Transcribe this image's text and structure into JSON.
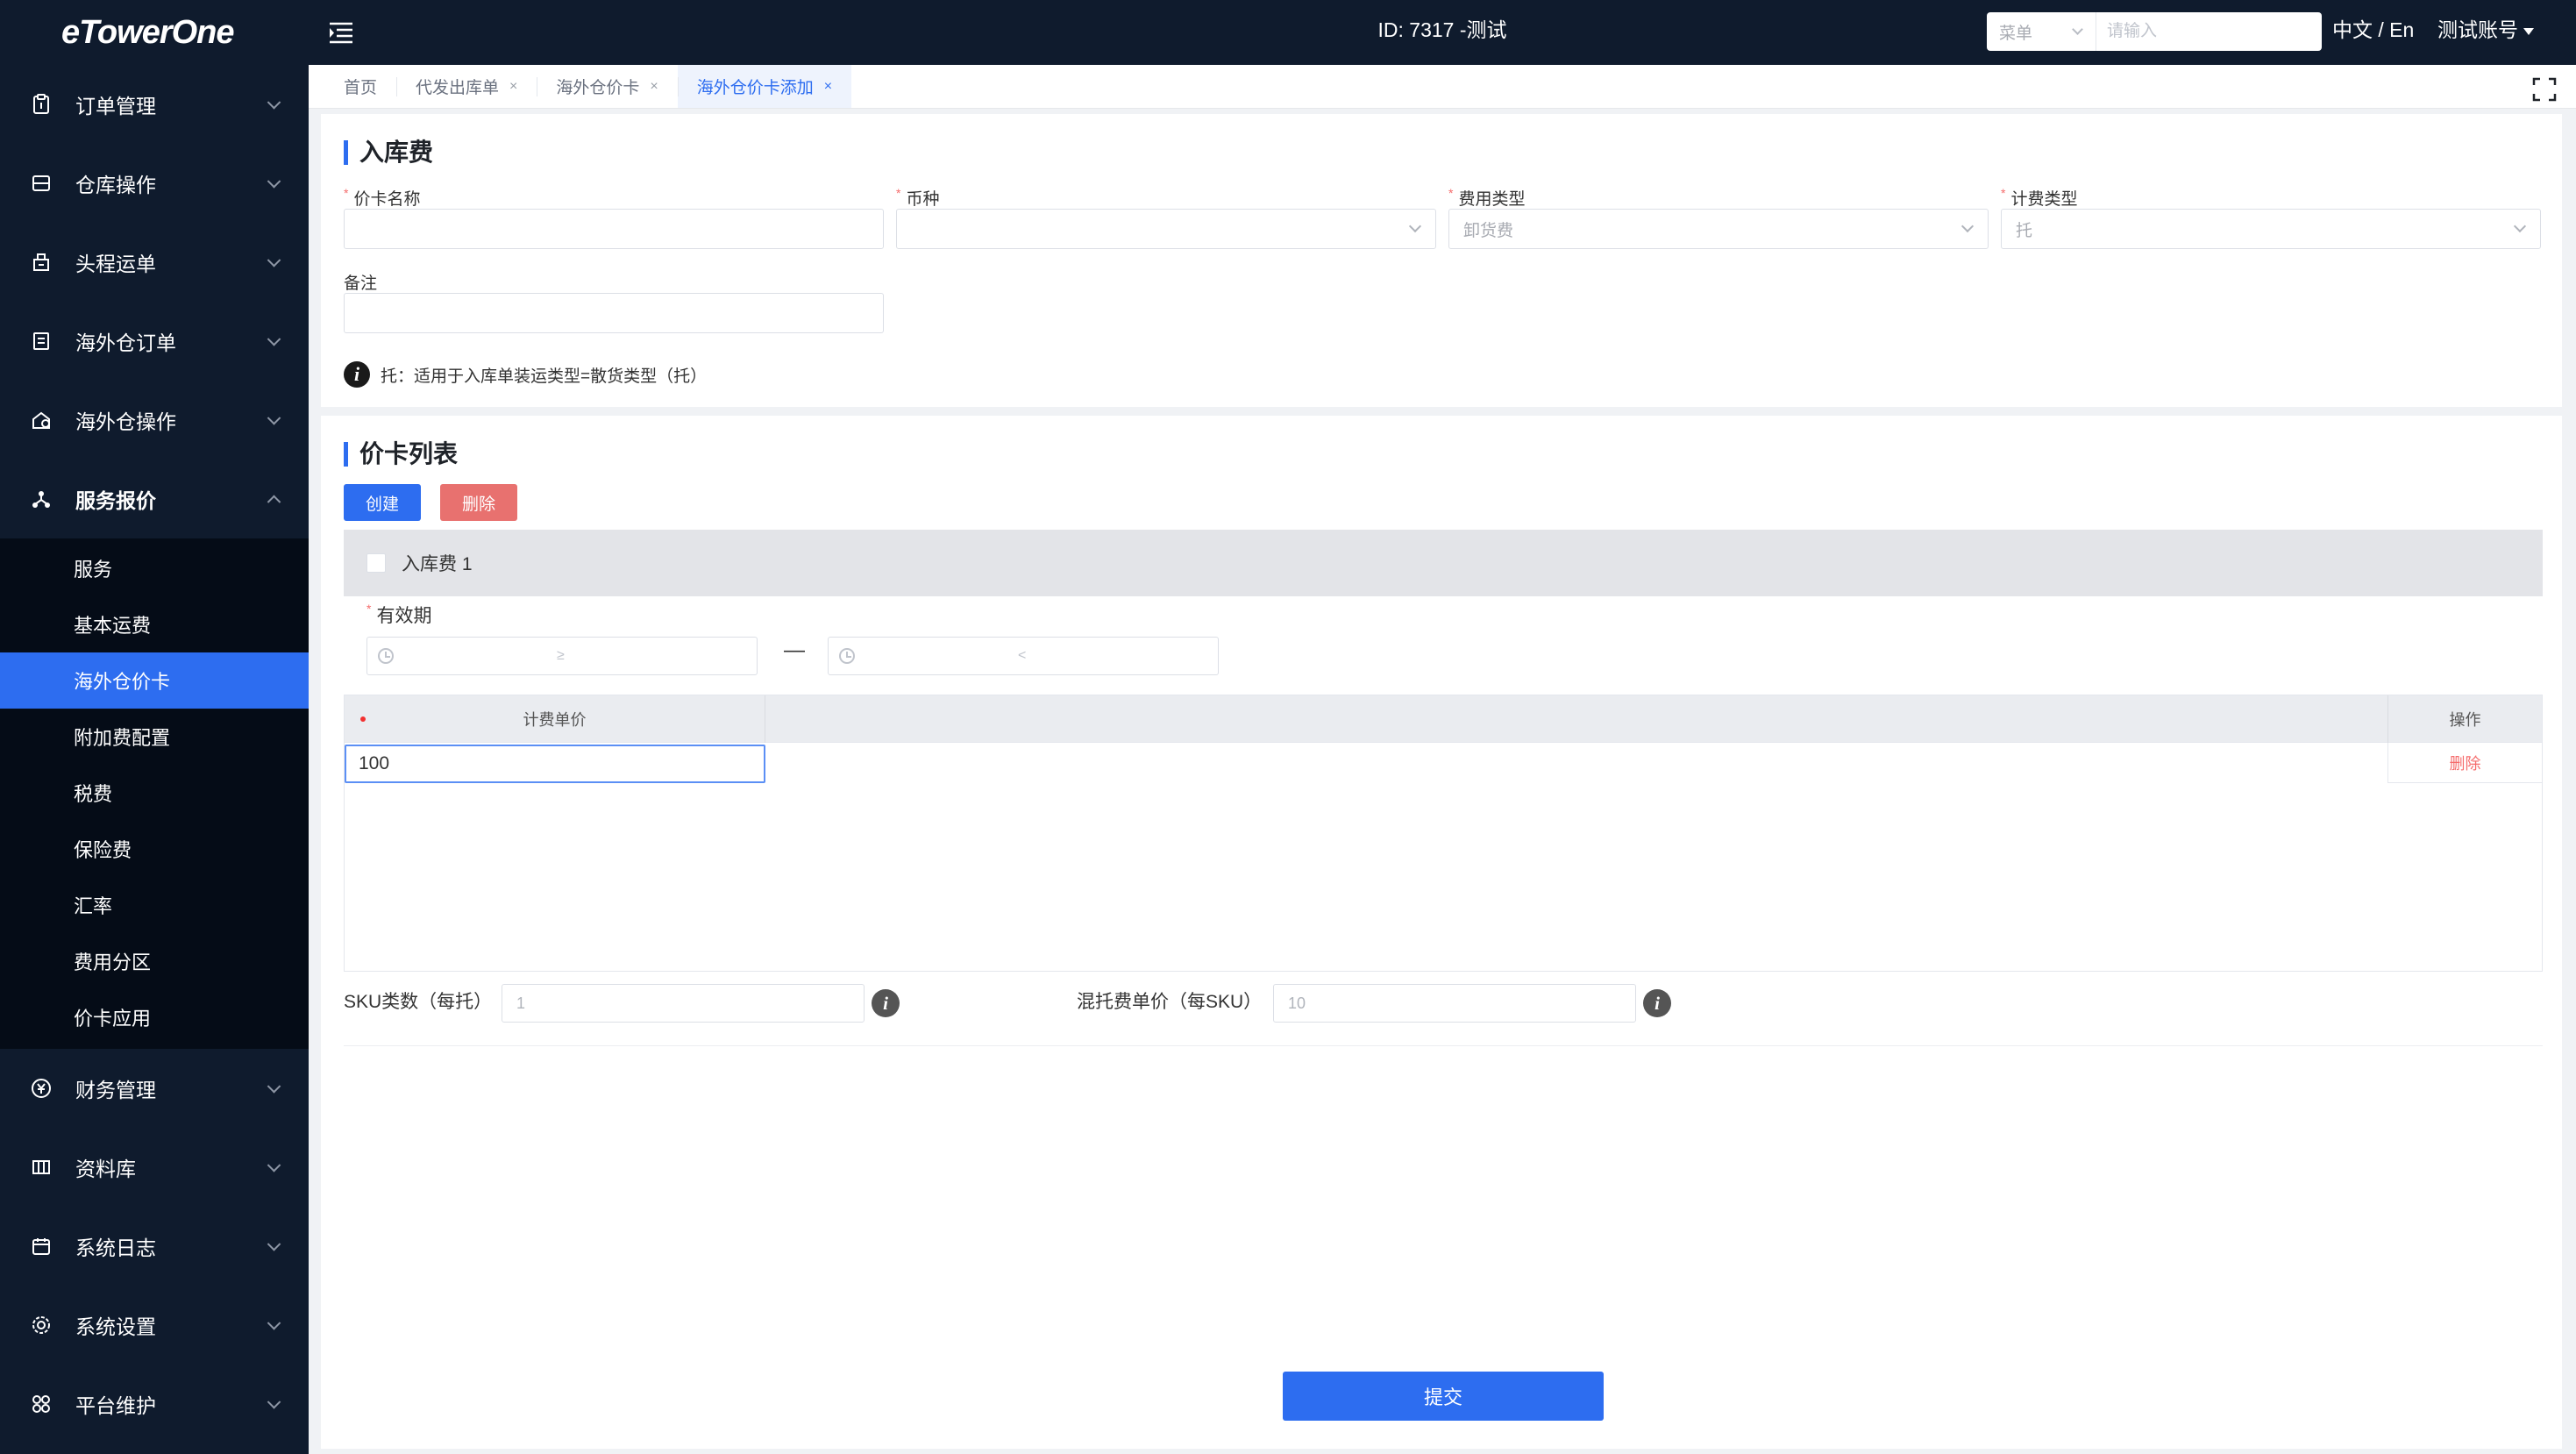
{
  "app": {
    "logo": "eTowerOne",
    "title": "ID: 7317 -测试",
    "search": {
      "select_label": "菜单",
      "placeholder": "请输入"
    },
    "language": "中文 / En",
    "account": "测试账号"
  },
  "sidebar": {
    "items": [
      {
        "label": "订单管理",
        "icon": "clipboard-icon"
      },
      {
        "label": "仓库操作",
        "icon": "warehouse-icon"
      },
      {
        "label": "头程运单",
        "icon": "truck-icon"
      },
      {
        "label": "海外仓订单",
        "icon": "order-icon"
      },
      {
        "label": "海外仓操作",
        "icon": "overseas-warehouse-icon"
      },
      {
        "label": "服务报价",
        "icon": "network-icon"
      },
      {
        "label": "财务管理",
        "icon": "finance-icon"
      },
      {
        "label": "资料库",
        "icon": "database-icon"
      },
      {
        "label": "系统日志",
        "icon": "calendar-icon"
      },
      {
        "label": "系统设置",
        "icon": "gear-icon"
      },
      {
        "label": "平台维护",
        "icon": "platform-icon"
      }
    ],
    "submenu": [
      "服务",
      "基本运费",
      "海外仓价卡",
      "附加费配置",
      "税费",
      "保险费",
      "汇率",
      "费用分区",
      "价卡应用"
    ],
    "active_sub": "海外仓价卡"
  },
  "tabs": [
    {
      "label": "首页",
      "closable": false
    },
    {
      "label": "代发出库单",
      "closable": true
    },
    {
      "label": "海外仓价卡",
      "closable": true
    },
    {
      "label": "海外仓价卡添加",
      "closable": true,
      "active": true
    }
  ],
  "close_glyph": "×",
  "section1": {
    "title": "入库费",
    "fields": {
      "card_name": {
        "label": "价卡名称",
        "value": ""
      },
      "currency": {
        "label": "币种",
        "value": ""
      },
      "fee_type": {
        "label": "费用类型",
        "value": "卸货费"
      },
      "billing_type": {
        "label": "计费类型",
        "value": "托"
      },
      "remark": {
        "label": "备注",
        "value": ""
      }
    },
    "note": "托：适用于入库单装运类型=散货类型（托）"
  },
  "section2": {
    "title": "价卡列表",
    "create_label": "创建",
    "delete_label": "删除",
    "card": {
      "name": "入库费 1",
      "validity_label": "有效期",
      "date_from_placeholder": "≥",
      "date_to_placeholder": "<",
      "date_separator": "—",
      "table": {
        "col_unit_price": "计费单价",
        "col_action": "操作",
        "rows": [
          {
            "unit_price": "100",
            "action": "删除"
          }
        ]
      },
      "sku_count_label": "SKU类数（每托）",
      "sku_count_value": "1",
      "mixed_price_label": "混托费单价（每SKU）",
      "mixed_price_value": "10"
    },
    "submit_label": "提交"
  },
  "colors": {
    "primary": "#2d6df0",
    "danger": "#e8716f",
    "sidebar_bg": "#0f1b2d"
  }
}
